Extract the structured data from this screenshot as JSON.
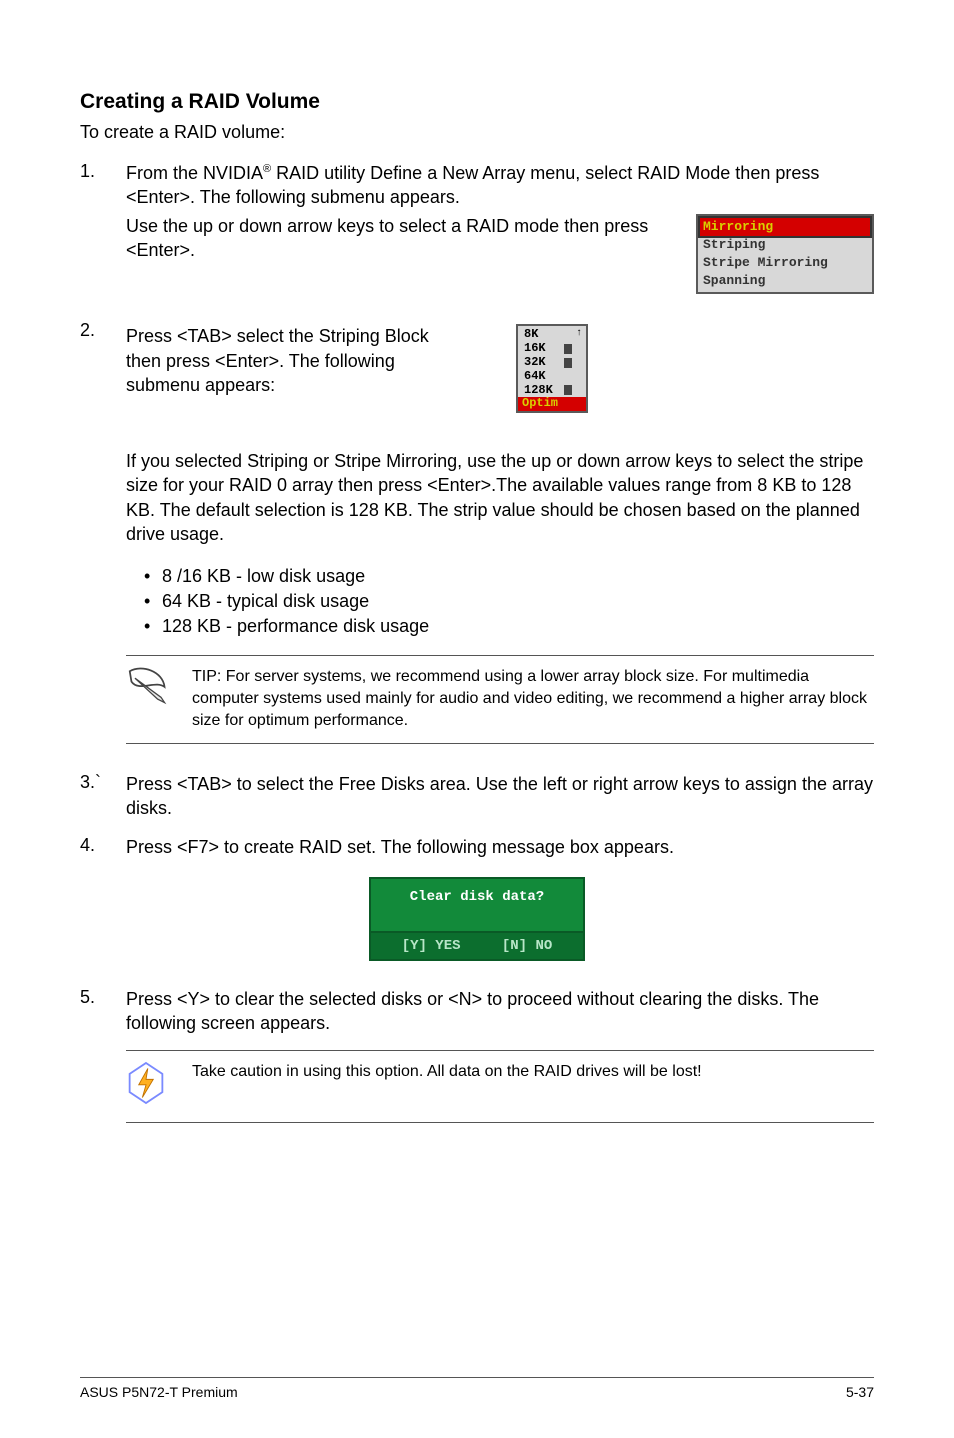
{
  "section": {
    "title": "Creating a RAID Volume",
    "intro": "To create a RAID volume:"
  },
  "steps": {
    "s1": {
      "num": "1.",
      "text_a": "From the NVIDIA",
      "reg": "®",
      "text_b": " RAID utility Define a New Array menu, select RAID Mode then press <Enter>. The following submenu appears.",
      "sub": "Use the up or down arrow keys to select a RAID mode then press <Enter>."
    },
    "s2": {
      "num": "2.",
      "text": "Press <TAB> select the Striping Block then press <Enter>. The following submenu appears:",
      "para": "If you selected Striping or Stripe Mirroring, use the up or down arrow keys to select the stripe size for your RAID 0 array then press <Enter>.The available values range from 8 KB to 128 KB. The default selection is 128 KB. The strip value should be chosen based on the planned drive usage.",
      "bul1": "8 /16 KB - low disk usage",
      "bul2": "64 KB - typical disk usage",
      "bul3": "128 KB - performance disk usage"
    },
    "s3": {
      "num": "3.`",
      "text": "Press <TAB> to select the Free Disks area. Use the left or right arrow keys to assign the array disks."
    },
    "s4": {
      "num": "4.",
      "text": "Press <F7> to create RAID set. The following message box appears."
    },
    "s5": {
      "num": "5.",
      "text": "Press <Y> to clear the selected disks or <N> to proceed without clearing the disks. The following screen appears."
    }
  },
  "raid_modes": {
    "m0": "Mirroring",
    "m1": "Striping",
    "m2": "Stripe Mirroring",
    "m3": "Spanning"
  },
  "stripe_sizes": {
    "s0": "8K",
    "s1": "16K",
    "s2": "32K",
    "s3": "64K",
    "s4": "128K",
    "s5": "Optim"
  },
  "tip": {
    "text": "TIP: For server systems, we recommend using a lower array block size. For multimedia computer systems used mainly for audio and video editing, we recommend a higher array block size for optimum performance."
  },
  "dialog": {
    "title": "Clear disk data?",
    "yes": "[Y] YES",
    "no": "[N] NO"
  },
  "warning": {
    "text": "Take caution in using this option. All data on the RAID drives will be lost!"
  },
  "footer": {
    "left": "ASUS P5N72-T Premium",
    "right": "5-37"
  }
}
